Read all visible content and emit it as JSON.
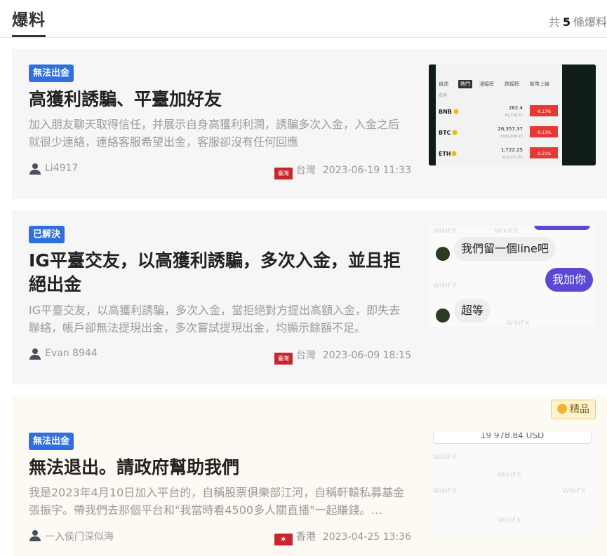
{
  "header": {
    "title": "爆料",
    "count_prefix": "共",
    "count_value": "5",
    "count_suffix": "條爆料"
  },
  "items": [
    {
      "badge": "無法出金",
      "title": "高獲利誘騙、平臺加好友",
      "description": "加入朋友聊天取得信任，并展示自身高獲利利潤，誘騙多次入金，入金之后就很少連絡，連絡客服希望出金，客服卻沒有任何回應",
      "user": "Li4917",
      "flag_text": "臺灣",
      "region": "台灣",
      "date": "2023-06-19 11:33",
      "thumb": {
        "tabs": [
          "自选",
          "熱門",
          "漲幅榜",
          "跌幅榜",
          "新幣上線"
        ],
        "column": "名称",
        "rows": [
          {
            "coin": "BNB",
            "price": "262.4",
            "sub": "¥1,738.71",
            "change": "-0.17%"
          },
          {
            "coin": "BTC",
            "price": "26,357.37",
            "sub": "¥181,938.22",
            "change": "-0.13%"
          },
          {
            "coin": "ETH",
            "price": "1,722.25",
            "sub": "¥12,371.65",
            "change": "-0.21%"
          }
        ]
      }
    },
    {
      "badge": "已解決",
      "title": "IG平臺交友，以高獲利誘騙，多次入金，並且拒絕出金",
      "description": "IG平臺交友，以高獲利誘騙，多次入金，當拒絕對方提出高額入金，即失去聯絡，帳戶卻無法提現出金，多次嘗試提現出金，均顯示餘額不足。",
      "user": "Evan 8944",
      "flag_text": "臺灣",
      "region": "台灣",
      "date": "2023-06-09 18:15",
      "thumb": {
        "messages": [
          "我們留一個line吧",
          "我加你",
          "超等"
        ],
        "watermark": "WikiFX"
      }
    },
    {
      "badge": "無法出金",
      "premium_label": "精品",
      "title": "無法退出。請政府幫助我們",
      "description": "我是2023年4月10日加入平台的，自稱股票俱樂部江河，自稱軒轅私募基金張振宇。帶我們去那個平台和\"我當時看4500多人關直播\"一起賺錢。…",
      "user": "一入侯门深似海",
      "flag_text": "✶",
      "region": "香港",
      "date": "2023-04-25 13:36",
      "thumb": {
        "amount": "19 978.84 USD",
        "watermark": "WikiFX"
      }
    }
  ],
  "colors": {
    "badge": "#2f6fde",
    "flag": "#c9252c",
    "down": "#e53935",
    "chat_out": "#5b49d6"
  }
}
